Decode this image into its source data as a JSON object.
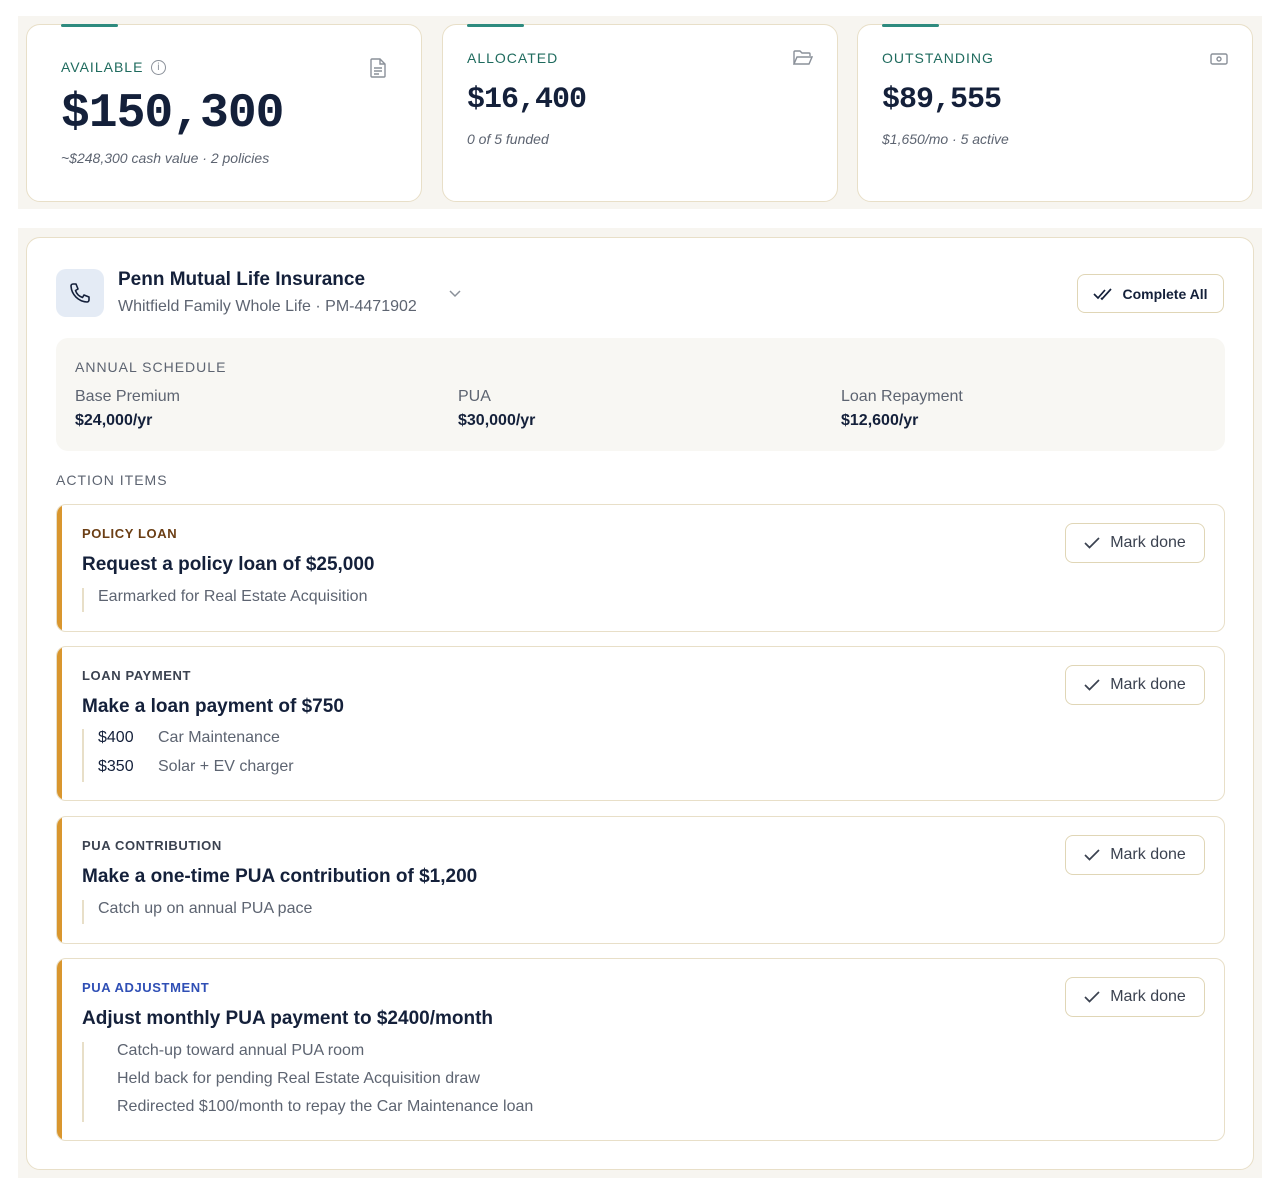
{
  "stats": [
    {
      "label": "AVAILABLE",
      "value": "$150,300",
      "sub": "~$248,300 cash value · 2 policies",
      "icon": "document-icon"
    },
    {
      "label": "ALLOCATED",
      "value": "$16,400",
      "sub": "0 of 5 funded",
      "icon": "folder-open-icon"
    },
    {
      "label": "OUTSTANDING",
      "value": "$89,555",
      "sub": "$1,650/mo · 5 active",
      "icon": "cash-icon"
    }
  ],
  "policy": {
    "name": "Penn Mutual Life Insurance",
    "subtitle": "Whitfield Family Whole Life · PM-4471902",
    "complete_all_label": "Complete All"
  },
  "schedule": {
    "title": "ANNUAL SCHEDULE",
    "items": [
      {
        "label": "Base Premium",
        "value": "$24,000/yr"
      },
      {
        "label": "PUA",
        "value": "$30,000/yr"
      },
      {
        "label": "Loan Repayment",
        "value": "$12,600/yr"
      }
    ]
  },
  "actions_title": "ACTION ITEMS",
  "actions": [
    {
      "category": "POLICY LOAN",
      "category_color": "#6b3e14",
      "title": "Request a policy loan of $25,000",
      "details": [
        {
          "amount": "",
          "text": "Earmarked for Real Estate Acquisition"
        }
      ],
      "button": "Mark done"
    },
    {
      "category": "LOAN PAYMENT",
      "category_color": "#3b4250",
      "title": "Make a loan payment of $750",
      "details": [
        {
          "amount": "$400",
          "text": "Car Maintenance"
        },
        {
          "amount": "$350",
          "text": "Solar + EV charger"
        }
      ],
      "button": "Mark done"
    },
    {
      "category": "PUA CONTRIBUTION",
      "category_color": "#3b4250",
      "title": "Make a one-time PUA contribution of $1,200",
      "details": [
        {
          "amount": "",
          "text": "Catch up on annual PUA pace"
        }
      ],
      "button": "Mark done"
    },
    {
      "category": "PUA ADJUSTMENT",
      "category_color": "#2f4fb5",
      "title": "Adjust monthly PUA payment to $2400/month",
      "details": [
        {
          "amount": "",
          "text": "Catch-up toward annual PUA room"
        },
        {
          "amount": "",
          "text": "Held back for pending Real Estate Acquisition draw"
        },
        {
          "amount": "",
          "text": "Redirected $100/month to repay the Car Maintenance loan"
        }
      ],
      "button": "Mark done"
    }
  ],
  "colors": {
    "accent_teal": "#2e8b7f",
    "accent_amber": "#d9962e"
  }
}
